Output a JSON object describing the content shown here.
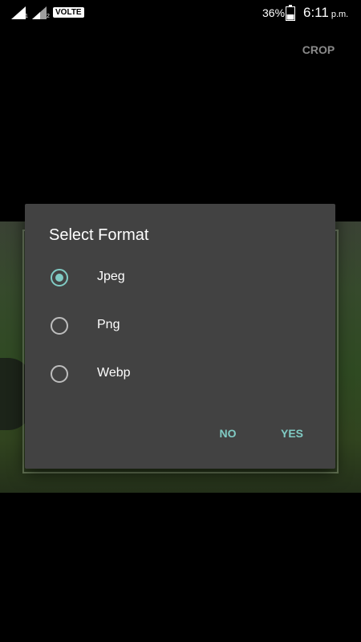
{
  "status_bar": {
    "sim1": "1",
    "sim2": "2",
    "network_badge": "VOLTE",
    "battery_percent": "36%",
    "time": "6:11",
    "ampm": "p.m.",
    "icons": [
      "signal-icon",
      "signal-icon",
      "battery-icon"
    ]
  },
  "toolbar": {
    "crop_label": "CROP"
  },
  "dialog": {
    "title": "Select Format",
    "options": [
      {
        "label": "Jpeg",
        "checked": true
      },
      {
        "label": "Png",
        "checked": false
      },
      {
        "label": "Webp",
        "checked": false
      }
    ],
    "no_label": "NO",
    "yes_label": "YES"
  },
  "colors": {
    "accent": "#80cbc4",
    "dialog_bg": "#424242",
    "background": "#000000"
  }
}
